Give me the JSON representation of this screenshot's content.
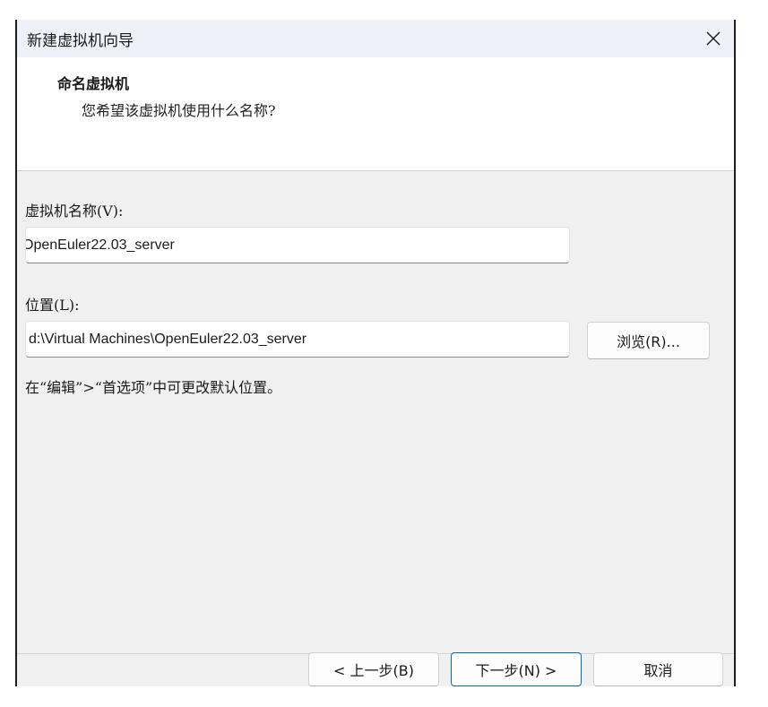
{
  "window": {
    "title": "新建虚拟机向导"
  },
  "header": {
    "title": "命名虚拟机",
    "subtitle": "您希望该虚拟机使用什么名称?"
  },
  "form": {
    "name_label": "虚拟机名称(V):",
    "name_value": "OpenEuler22.03_server",
    "location_label": "位置(L):",
    "location_value": "d:\\Virtual Machines\\OpenEuler22.03_server",
    "browse_label": "浏览(R)...",
    "hint": "在“编辑”>“首选项”中可更改默认位置。"
  },
  "footer": {
    "back_label": "< 上一步(B)",
    "next_label": "下一步(N) >",
    "cancel_label": "取消"
  },
  "colors": {
    "accent": "#0067c0",
    "titlebar": "#eef2f8",
    "dialog_bg": "#f0f0f0"
  },
  "icons": {
    "close": "close-icon"
  }
}
